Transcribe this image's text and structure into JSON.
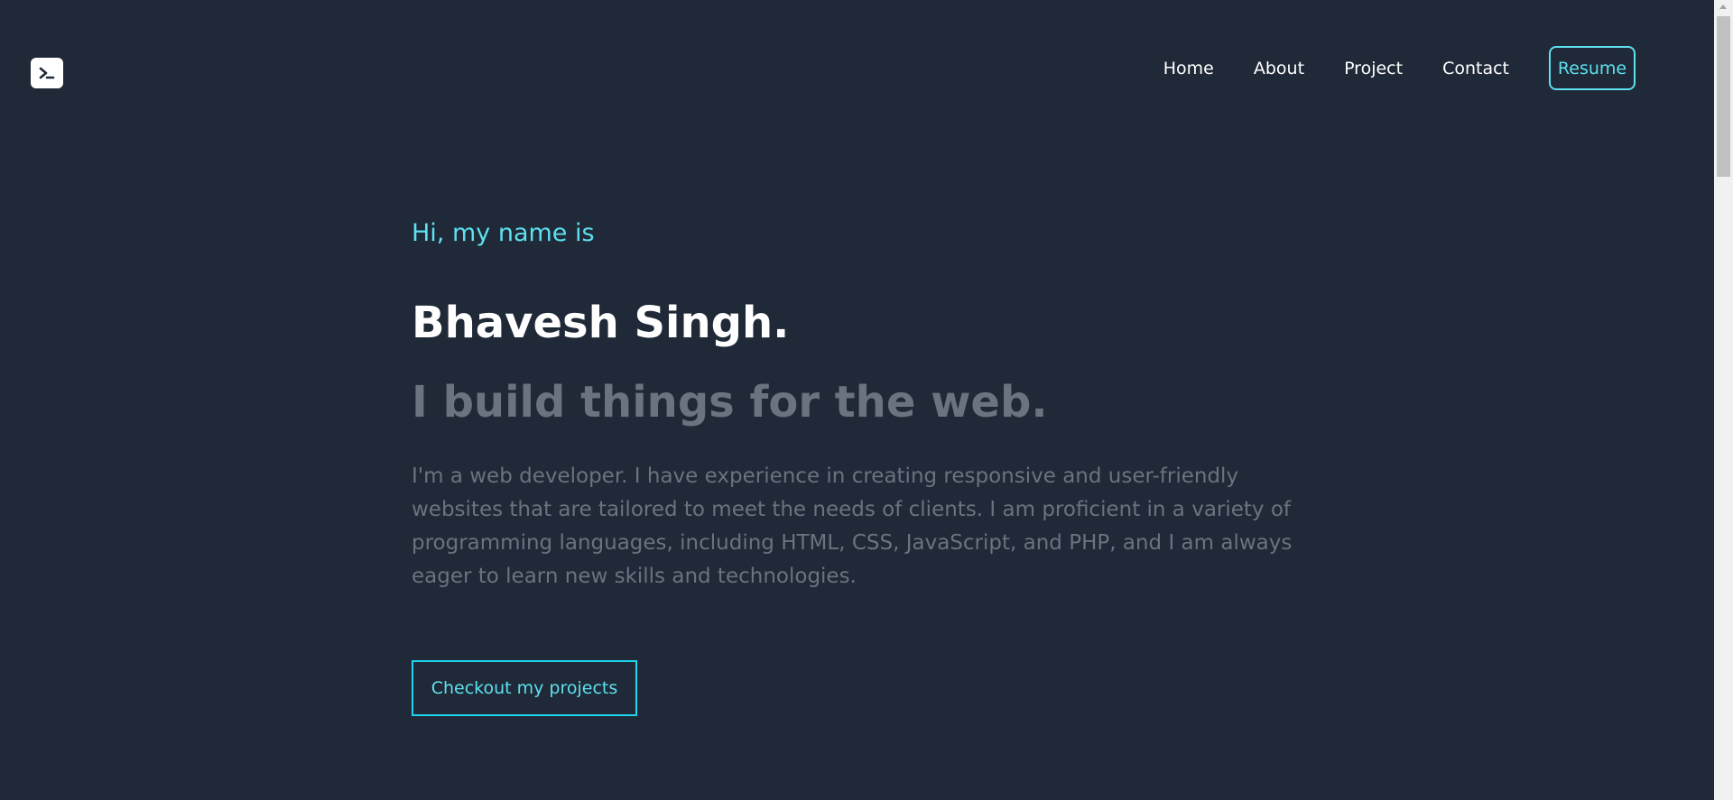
{
  "header": {
    "logo_icon": "terminal-icon",
    "nav": [
      {
        "label": "Home"
      },
      {
        "label": "About"
      },
      {
        "label": "Project"
      },
      {
        "label": "Contact"
      }
    ],
    "resume_label": "Resume"
  },
  "hero": {
    "greeting": "Hi, my name is",
    "name": "Bhavesh Singh.",
    "tagline": "I build things for the web.",
    "bio": "I'm a web developer. I have experience in creating responsive and user-friendly websites that are tailored to meet the needs of clients. I am proficient in a variety of programming languages, including HTML, CSS, JavaScript, and PHP, and I am always eager to learn new skills and technologies.",
    "cta_label": "Checkout my projects"
  },
  "colors": {
    "background": "#1f2937",
    "accent": "#5ee0ef",
    "muted_text": "#6b7280",
    "heading": "#ffffff"
  }
}
